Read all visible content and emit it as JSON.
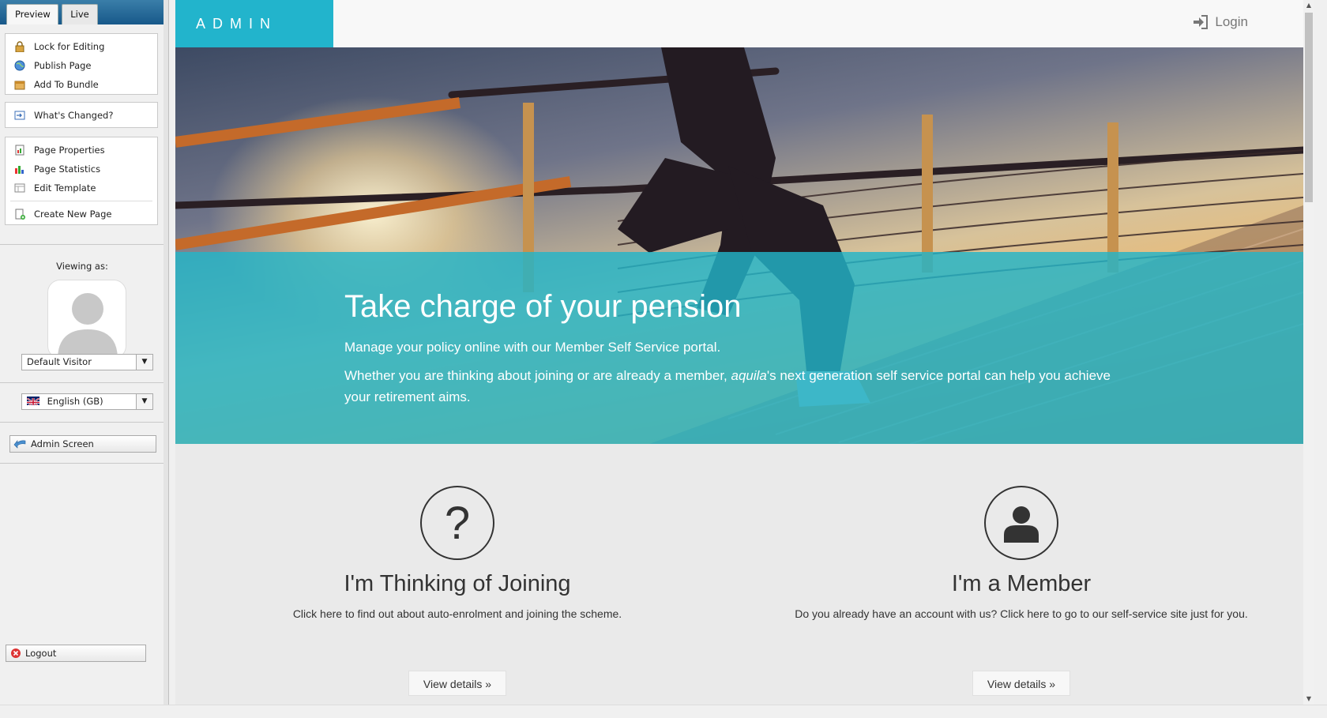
{
  "cms": {
    "tabs": [
      "Preview",
      "Live"
    ],
    "actions": [
      {
        "label": "Lock for Editing",
        "icon": "lock-icon"
      },
      {
        "label": "Publish Page",
        "icon": "globe-icon"
      },
      {
        "label": "Add To Bundle",
        "icon": "bundle-icon"
      }
    ],
    "whats_changed": "What's Changed?",
    "page_tools": [
      {
        "label": "Page Properties",
        "icon": "properties-icon"
      },
      {
        "label": "Page Statistics",
        "icon": "statistics-icon"
      },
      {
        "label": "Edit Template",
        "icon": "template-icon"
      }
    ],
    "create_page": "Create New Page",
    "viewing_as": "Viewing as:",
    "visitor_select": "Default Visitor",
    "language_select": "English (GB)",
    "admin_screen": "Admin Screen",
    "logout": "Logout"
  },
  "site": {
    "brand": "ADMIN",
    "login": "Login",
    "hero": {
      "title": "Take charge of your pension",
      "subtitle": "Manage your policy online with our Member Self Service portal.",
      "body_pre": "Whether you are thinking about joining or are already a member, ",
      "body_em": "aquila",
      "body_post": "'s next generation self service portal can help you achieve your retirement aims."
    },
    "columns": [
      {
        "icon": "question-icon",
        "title": "I'm Thinking of Joining",
        "text": "Click here to find out about auto-enrolment and joining the scheme.",
        "button": "View details »"
      },
      {
        "icon": "user-icon",
        "title": "I'm a Member",
        "text": "Do you already have an account with us? Click here to go to our self-service site just for you.",
        "button": "View details »"
      }
    ]
  },
  "colors": {
    "brand": "#22b4cc",
    "cms_header": "#17588a"
  }
}
